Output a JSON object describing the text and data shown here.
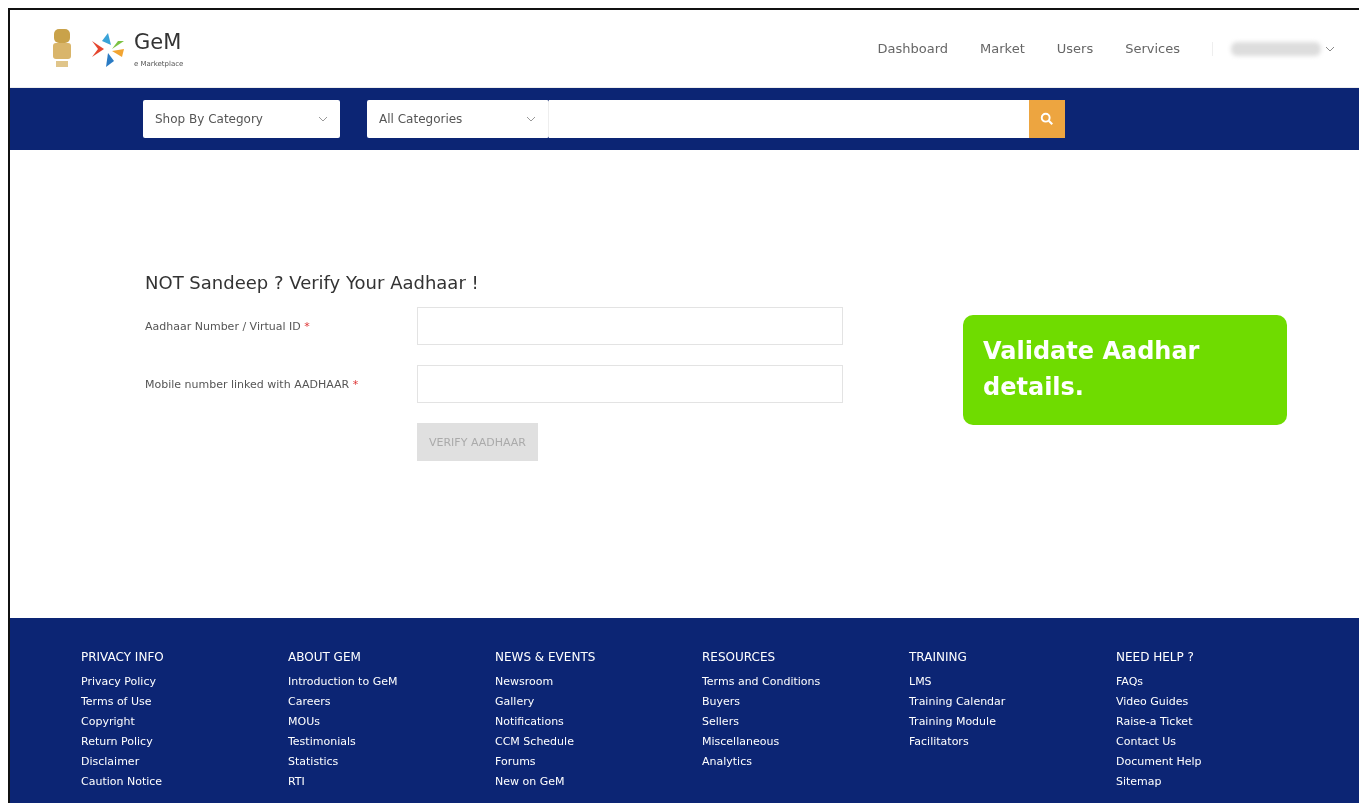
{
  "header": {
    "brand": "GeM",
    "brand_sub": "e Marketplace",
    "nav": [
      {
        "label": "Dashboard"
      },
      {
        "label": "Market"
      },
      {
        "label": "Users"
      },
      {
        "label": "Services"
      }
    ]
  },
  "search_bar": {
    "category_select": "Shop By Category",
    "scope_select": "All Categories"
  },
  "form": {
    "title": "NOT Sandeep ? Verify Your Aadhaar !",
    "fields": [
      {
        "label": "Aadhaar Number / Virtual ID",
        "required_mark": "*"
      },
      {
        "label": "Mobile number linked with AADHAAR",
        "required_mark": "*"
      }
    ],
    "button": {
      "label": "VERIFY AADHAAR",
      "disabled": true
    }
  },
  "callout": {
    "text": "Validate Aadhar details."
  },
  "footer": {
    "columns": [
      {
        "heading": "PRIVACY INFO",
        "links": [
          "Privacy Policy",
          "Terms of Use",
          "Copyright",
          "Return Policy",
          "Disclaimer",
          "Caution Notice"
        ]
      },
      {
        "heading": "ABOUT GEM",
        "links": [
          "Introduction to GeM",
          "Careers",
          "MOUs",
          "Testimonials",
          "Statistics",
          "RTI"
        ]
      },
      {
        "heading": "NEWS & EVENTS",
        "links": [
          "Newsroom",
          "Gallery",
          "Notifications",
          "CCM Schedule",
          "Forums",
          "New on GeM"
        ]
      },
      {
        "heading": "RESOURCES",
        "links": [
          "Terms and Conditions",
          "Buyers",
          "Sellers",
          "Miscellaneous",
          "Analytics"
        ]
      },
      {
        "heading": "TRAINING",
        "links": [
          "LMS",
          "Training Calendar",
          "Training Module",
          "Facilitators"
        ]
      },
      {
        "heading": "NEED HELP ?",
        "links": [
          "FAQs",
          "Video Guides",
          "Raise-a Ticket",
          "Contact Us",
          "Document Help",
          "Sitemap"
        ]
      }
    ]
  }
}
